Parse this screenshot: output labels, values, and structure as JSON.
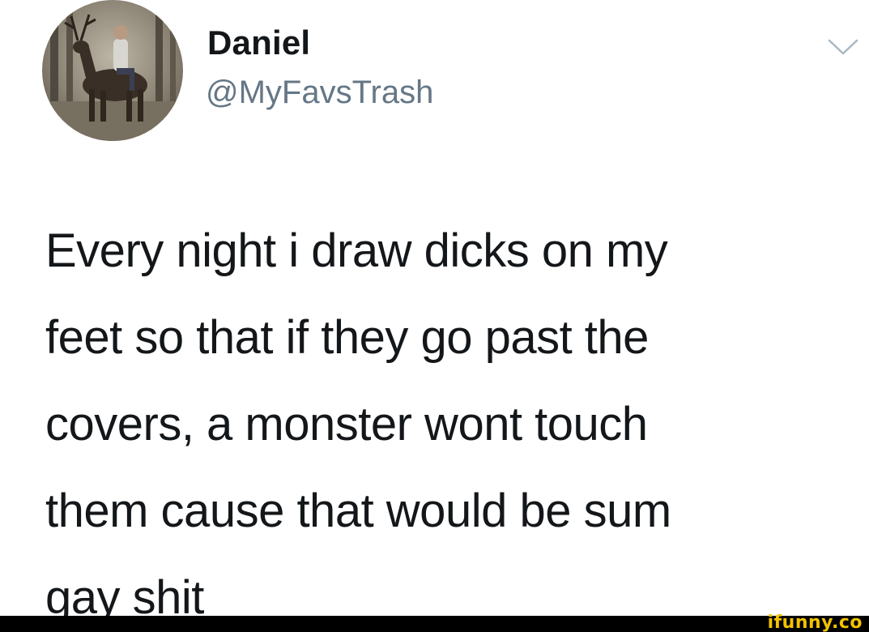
{
  "tweet": {
    "author": {
      "display_name": "Daniel",
      "handle": "@MyFavsTrash",
      "avatar_icon": "avatar-photo-deer-rider"
    },
    "menu_icon": "chevron-down-icon",
    "text_lines": [
      "Every night i draw dicks on my",
      "feet so that if they go past the",
      "covers, a monster wont touch",
      "them cause that would be sum",
      "gay shit"
    ]
  },
  "watermark": {
    "text": "ifunny.co",
    "color": "#f2c200"
  },
  "colors": {
    "text_primary": "#14171a",
    "text_secondary": "#657786",
    "footer_bar": "#000000"
  }
}
